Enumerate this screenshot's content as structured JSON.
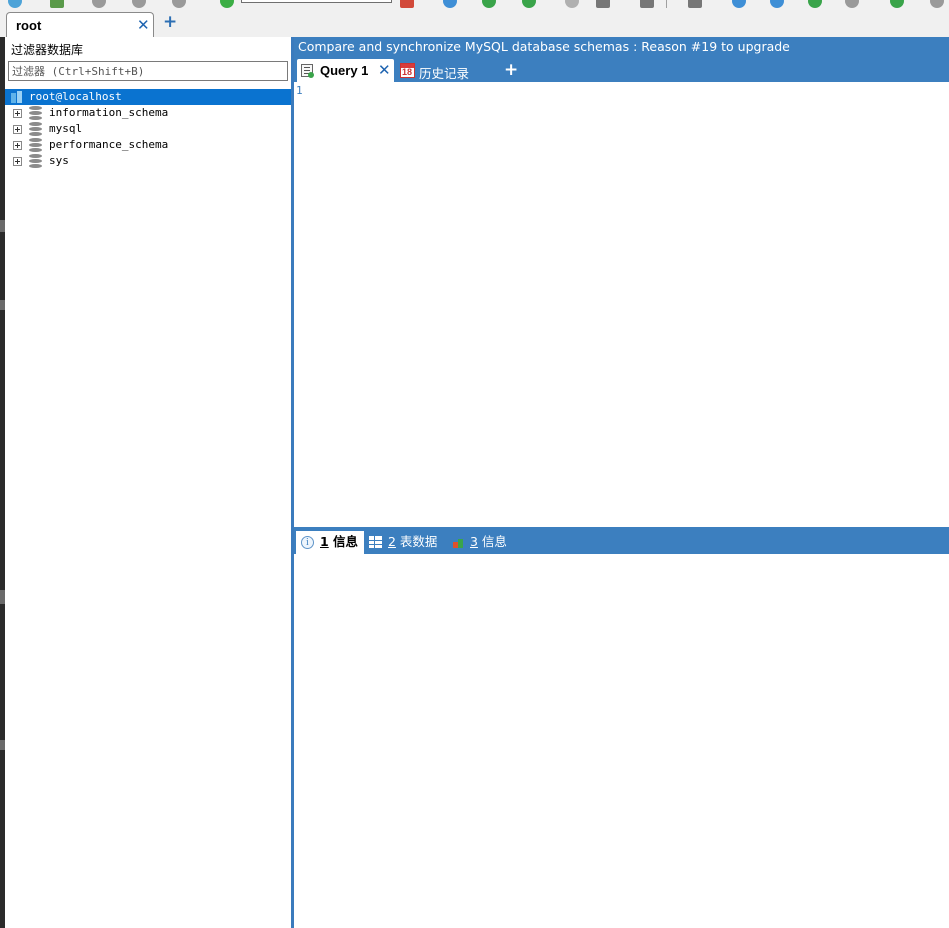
{
  "connection_tabs": {
    "active_label": "root",
    "close_glyph": "✕",
    "add_glyph": "+"
  },
  "object_browser": {
    "filter_label": "过滤器数据库",
    "filter_placeholder": "过滤器 (Ctrl+Shift+B)",
    "host": "root@localhost",
    "databases": [
      "information_schema",
      "mysql",
      "performance_schema",
      "sys"
    ]
  },
  "promo_banner": "Compare and synchronize MySQL database schemas : Reason #19 to upgrade",
  "editor_tabs": {
    "query_label": "Query 1",
    "query_close": "✕",
    "history_label": "历史记录",
    "history_icon_day": "18",
    "add_glyph": "+"
  },
  "editor": {
    "line_number": "1"
  },
  "result_tabs": [
    {
      "num": "1",
      "label": " 信息"
    },
    {
      "num": "2",
      "label": " 表数据"
    },
    {
      "num": "3",
      "label": " 信息"
    }
  ],
  "colors": {
    "accent": "#3c7fbf",
    "selection": "#0a73d0"
  }
}
